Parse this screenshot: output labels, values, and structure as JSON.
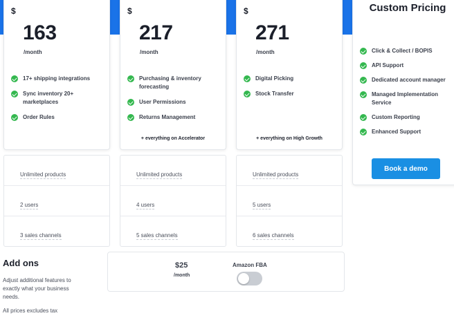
{
  "plans": [
    {
      "currency": "$",
      "price": "163",
      "per": "/month",
      "features": [
        "17+ shipping integrations",
        "Sync inventory 20+ marketplaces",
        "Order Rules"
      ],
      "everything": "",
      "limits": [
        "Unlimited products",
        "2 users",
        "3 sales channels"
      ]
    },
    {
      "currency": "$",
      "price": "217",
      "per": "/month",
      "features": [
        "Purchasing & inventory forecasting",
        "User Permissions",
        "Returns Management"
      ],
      "everything": "+ everything on Accelerator",
      "limits": [
        "Unlimited products",
        "4 users",
        "5 sales channels"
      ]
    },
    {
      "currency": "$",
      "price": "271",
      "per": "/month",
      "features": [
        "Digital Picking",
        "Stock Transfer"
      ],
      "everything": "+ everything on High Growth",
      "limits": [
        "Unlimited products",
        "5 users",
        "6 sales channels"
      ]
    }
  ],
  "enterprise": {
    "title": "Custom Pricing",
    "features": [
      "Click & Collect / BOPIS",
      "API Support",
      "Dedicated account manager",
      "Managed Implementation Service",
      "Custom Reporting",
      "Enhanced Support"
    ],
    "button": "Book a demo"
  },
  "addons": {
    "title": "Add ons",
    "description": "Adjust additional features to exactly what your business needs.",
    "tax_note": "All prices excludes tax",
    "item": {
      "price": "$25",
      "per": "/month",
      "name": "Amazon FBA",
      "enabled": false
    }
  },
  "colors": {
    "accent": "#1a73e8",
    "button": "#1a8fe3",
    "check": "#34b84f",
    "toggle_off": "#c9cdd3"
  },
  "icons": {
    "feature": "check-circle-icon"
  }
}
